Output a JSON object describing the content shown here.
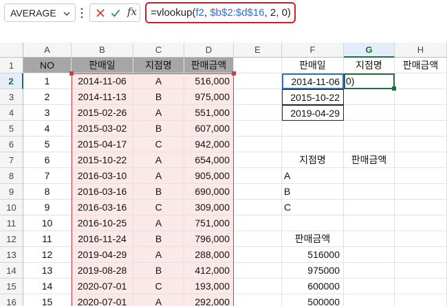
{
  "name_box": {
    "value": "AVERAGE"
  },
  "formula_bar": {
    "parts": [
      {
        "text": "=vlookup(",
        "ref": false
      },
      {
        "text": "f2",
        "ref": true
      },
      {
        "text": ", ",
        "ref": false
      },
      {
        "text": "$b$2:$d$16",
        "ref": true
      },
      {
        "text": ", 2, 0)",
        "ref": false
      }
    ],
    "fx_label": "fx"
  },
  "columns": [
    "A",
    "B",
    "C",
    "D",
    "E",
    "F",
    "G",
    "H"
  ],
  "rows": [
    "1",
    "2",
    "3",
    "4",
    "5",
    "6",
    "7",
    "8",
    "9",
    "10",
    "11",
    "12",
    "13",
    "14",
    "15",
    "16"
  ],
  "table": {
    "headers": [
      "NO",
      "판매일",
      "지점명",
      "판매금액"
    ],
    "records": [
      [
        "1",
        "2014-11-06",
        "A",
        "516,000"
      ],
      [
        "2",
        "2014-11-13",
        "B",
        "975,000"
      ],
      [
        "3",
        "2015-02-26",
        "A",
        "551,000"
      ],
      [
        "4",
        "2015-03-02",
        "B",
        "607,000"
      ],
      [
        "5",
        "2015-04-17",
        "C",
        "942,000"
      ],
      [
        "6",
        "2015-10-22",
        "A",
        "654,000"
      ],
      [
        "7",
        "2016-03-10",
        "A",
        "905,000"
      ],
      [
        "8",
        "2016-03-16",
        "B",
        "690,000"
      ],
      [
        "9",
        "2016-03-16",
        "C",
        "309,000"
      ],
      [
        "10",
        "2016-10-25",
        "A",
        "751,000"
      ],
      [
        "11",
        "2016-11-24",
        "B",
        "796,000"
      ],
      [
        "12",
        "2019-04-29",
        "A",
        "288,000"
      ],
      [
        "13",
        "2019-08-28",
        "B",
        "412,000"
      ],
      [
        "14",
        "2020-07-01",
        "C",
        "193,000"
      ],
      [
        "15",
        "2020-07-01",
        "A",
        "292,000"
      ]
    ]
  },
  "lookup1": {
    "headers": [
      "판매일",
      "지점명",
      "판매금액"
    ],
    "dates": [
      "2014-11-06",
      "2015-10-22",
      "2019-04-29"
    ],
    "editing_tail": "0)"
  },
  "lookup2": {
    "headers": [
      "지점명",
      "판매금액"
    ],
    "branches": [
      "A",
      "B",
      "C"
    ]
  },
  "lookup3": {
    "header": "판매금액",
    "values": [
      "516000",
      "975000",
      "600000",
      "500000"
    ]
  },
  "colors": {
    "accent_green": "#1b6f3a",
    "ref_blue": "#2f6dcc",
    "range_red": "#b9454d",
    "formula_border": "#e0161e"
  }
}
